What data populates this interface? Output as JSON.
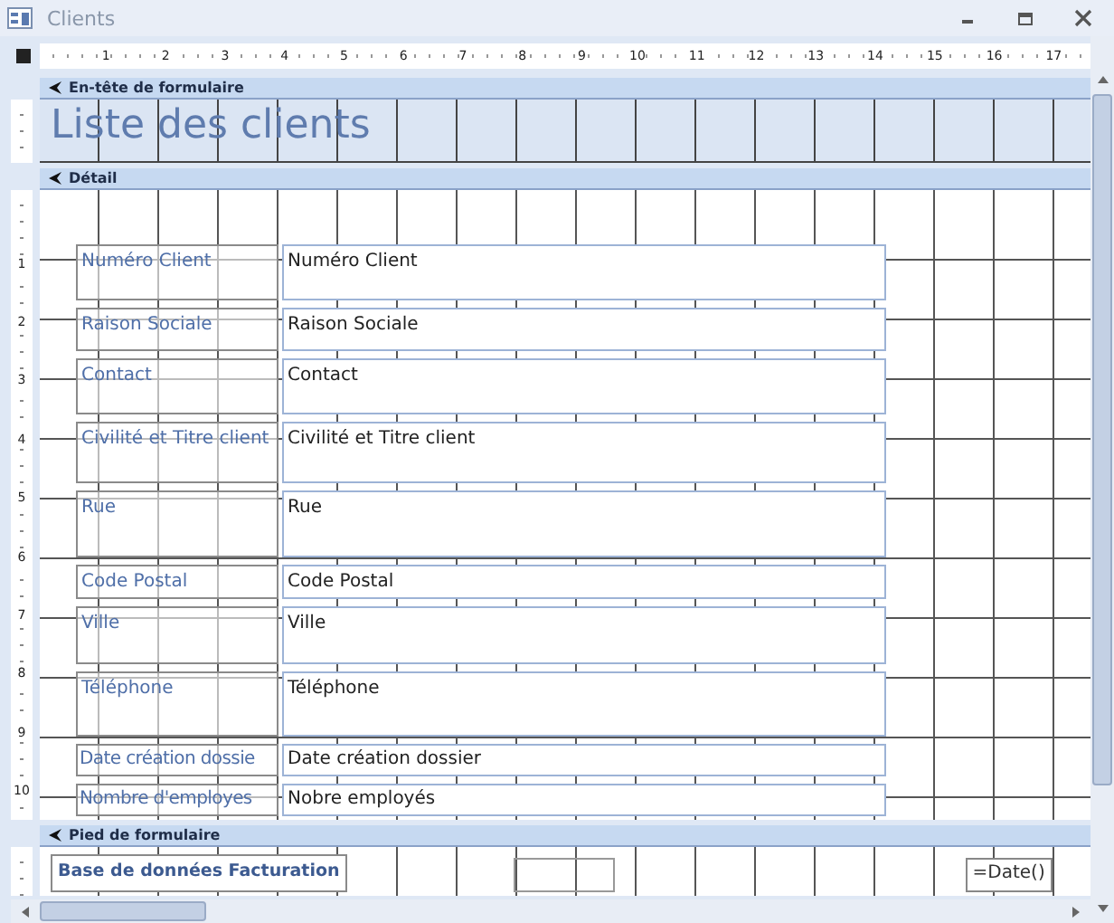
{
  "window": {
    "title": "Clients"
  },
  "ruler": {
    "marks": [
      "1",
      "2",
      "3",
      "4",
      "5",
      "6",
      "7",
      "8",
      "9",
      "10",
      "11",
      "12",
      "13",
      "14",
      "15",
      "16",
      "17"
    ]
  },
  "sections": [
    {
      "kind": "header",
      "title": "En-tête de formulaire",
      "controls": [
        {
          "kind": "title",
          "text": "Liste des clients"
        }
      ]
    },
    {
      "kind": "detail",
      "title": "Détail",
      "ruler_marks": [
        "1",
        "2",
        "3",
        "4",
        "5",
        "6",
        "7",
        "8",
        "9",
        "10"
      ],
      "fields": [
        {
          "label": "Numéro Client",
          "textbox": "Numéro Client"
        },
        {
          "label": "Raison Sociale",
          "textbox": "Raison Sociale"
        },
        {
          "label": "Contact",
          "textbox": "Contact"
        },
        {
          "label": "Civilité et Titre client",
          "textbox": "Civilité et Titre client"
        },
        {
          "label": "Rue",
          "textbox": "Rue"
        },
        {
          "label": "Code Postal",
          "textbox": "Code Postal"
        },
        {
          "label": "Ville",
          "textbox": "Ville"
        },
        {
          "label": "Téléphone",
          "textbox": "Téléphone"
        },
        {
          "label": "Date création dossie",
          "textbox": "Date création dossier"
        },
        {
          "label": "Nombre d'employes",
          "textbox": "Nobre employés"
        }
      ]
    },
    {
      "kind": "footer",
      "title": "Pied de formulaire",
      "controls": [
        {
          "kind": "label",
          "text": "Base de données Facturation"
        },
        {
          "kind": "box"
        },
        {
          "kind": "textbox",
          "text": "=Date()"
        }
      ]
    }
  ]
}
